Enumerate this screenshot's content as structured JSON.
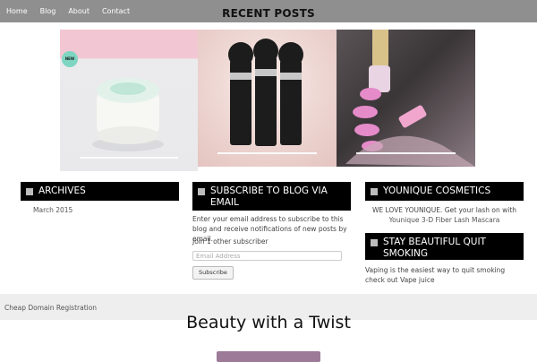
{
  "nav": {
    "items": [
      "Home",
      "Blog",
      "About",
      "Contact"
    ]
  },
  "page_heading": "RECENT POSTS",
  "posts": [
    {
      "badge": "NEW"
    },
    {},
    {}
  ],
  "archives": {
    "title": "ARCHIVES",
    "items": [
      "March 2015"
    ]
  },
  "subscribe": {
    "title": "SUBSCRIBE TO BLOG VIA EMAIL",
    "description": "Enter your email address to subscribe to this blog and receive notifications of new posts by email.",
    "subscribers": "Join 1 other subscriber",
    "email_placeholder": "Email Address",
    "button": "Subscribe"
  },
  "younique": {
    "title": "YOUNIQUE COSMETICS",
    "line1": "WE LOVE YOUNIQUE. Get your lash on with",
    "link": "Younique 3-D Fiber Lash Mascara"
  },
  "quit": {
    "title": "STAY BEAUTIFUL QUIT SMOKING",
    "text": "Vaping is the easiest way to quit smoking check out",
    "link": "Vape juice"
  },
  "footer": {
    "link": "Cheap Domain Registration"
  },
  "hero": {
    "title": "Beauty with a Twist"
  }
}
